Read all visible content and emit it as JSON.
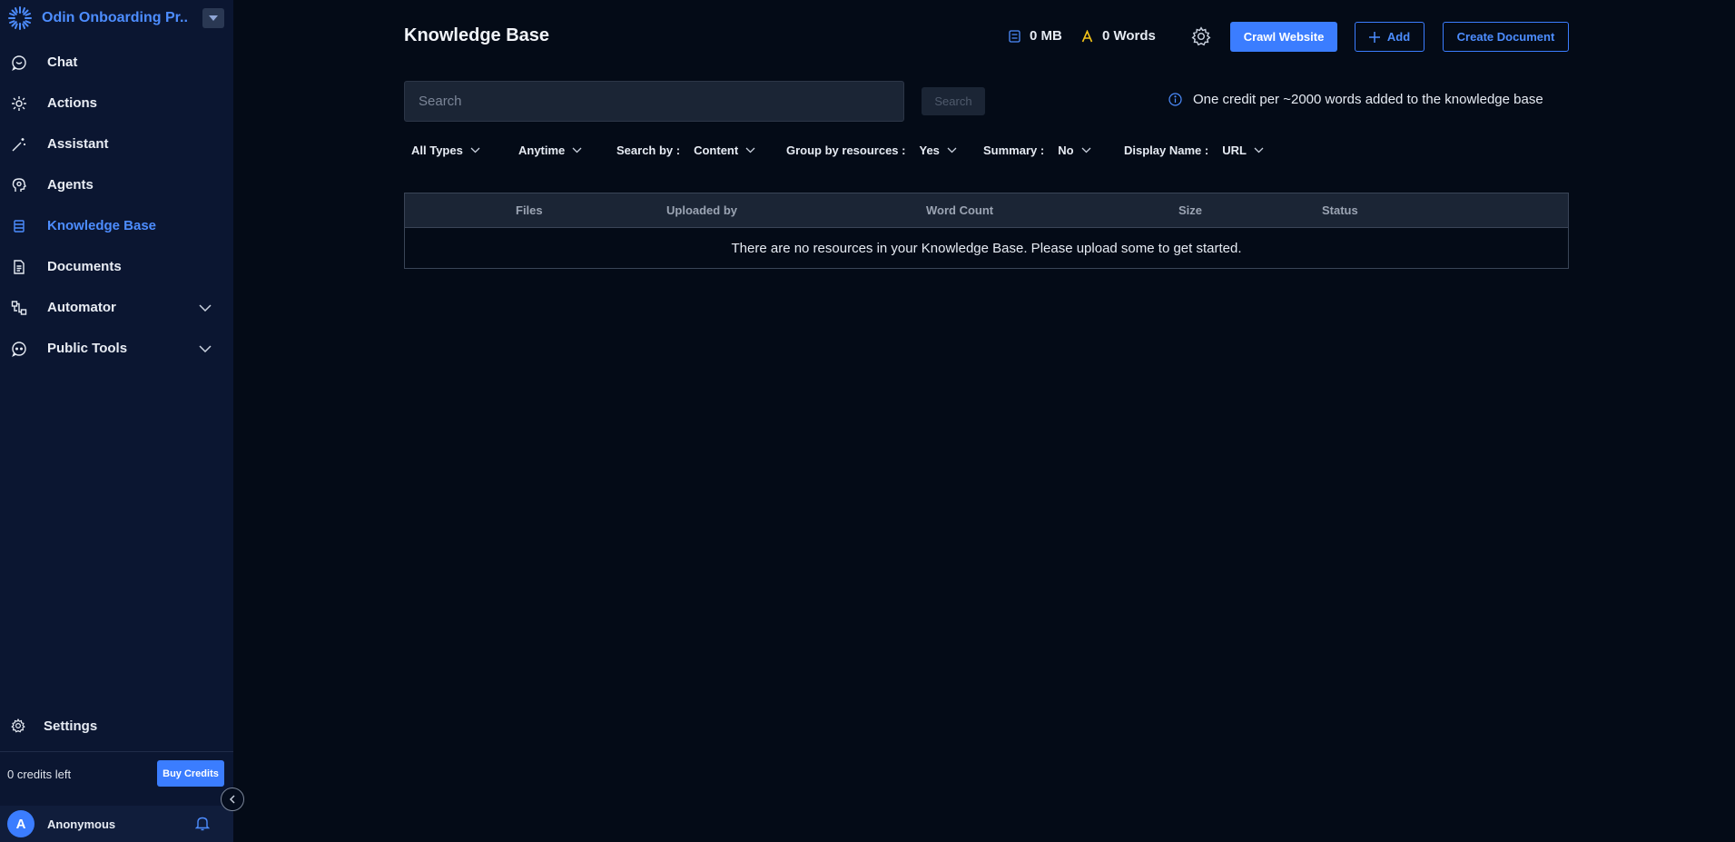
{
  "sidebar": {
    "workspace_name": "Odin Onboarding Pr...",
    "items": [
      {
        "label": "Chat",
        "icon": "chat-icon"
      },
      {
        "label": "Actions",
        "icon": "actions-icon"
      },
      {
        "label": "Assistant",
        "icon": "magic-wand-icon"
      },
      {
        "label": "Agents",
        "icon": "agent-head-icon"
      },
      {
        "label": "Knowledge Base",
        "icon": "database-icon",
        "active": true
      },
      {
        "label": "Documents",
        "icon": "document-icon"
      },
      {
        "label": "Automator",
        "icon": "workflow-icon",
        "expandable": true
      },
      {
        "label": "Public Tools",
        "icon": "bot-icon",
        "expandable": true
      }
    ],
    "settings_label": "Settings",
    "credits_text": "0 credits left",
    "buy_credits_label": "Buy Credits",
    "user_initial": "A",
    "user_name": "Anonymous"
  },
  "header": {
    "title": "Knowledge Base",
    "storage": "0 MB",
    "words": "0 Words",
    "crawl_label": "Crawl Website",
    "add_label": "Add",
    "create_label": "Create Document"
  },
  "search": {
    "placeholder": "Search",
    "button_label": "Search",
    "info_text": "One credit per ~2000 words added to the knowledge base"
  },
  "filters": {
    "type": "All Types",
    "time": "Anytime",
    "search_by_label": "Search by :",
    "search_by_value": "Content",
    "group_label": "Group by resources :",
    "group_value": "Yes",
    "summary_label": "Summary :",
    "summary_value": "No",
    "display_label": "Display Name :",
    "display_value": "URL"
  },
  "table": {
    "columns": [
      "Files",
      "Uploaded by",
      "Word Count",
      "Size",
      "Status"
    ],
    "empty_message": "There are no resources in your Knowledge Base. Please upload some to get started."
  },
  "colors": {
    "accent": "#3b7dff",
    "sidebar_bg": "#0b1631",
    "main_bg": "#040b17",
    "words_icon": "#f5c518"
  }
}
